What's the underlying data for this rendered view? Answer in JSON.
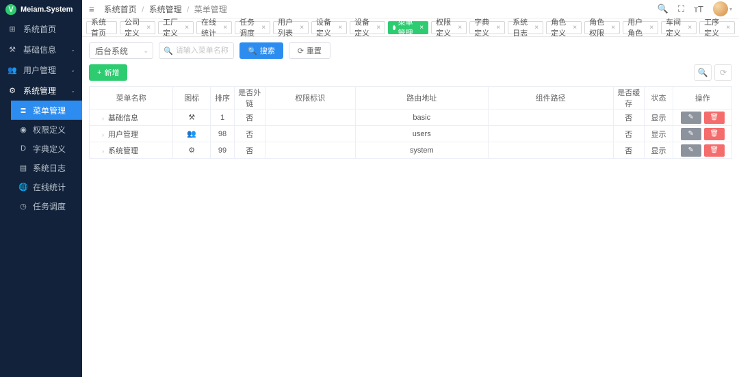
{
  "brand": {
    "initial": "V",
    "name": "Meiam.System"
  },
  "sidebar": {
    "items": [
      {
        "icon": "⊞",
        "label": "系统首页",
        "expandable": false
      },
      {
        "icon": "⚒",
        "label": "基础信息",
        "expandable": true
      },
      {
        "icon": "👥",
        "label": "用户管理",
        "expandable": true
      },
      {
        "icon": "⚙",
        "label": "系统管理",
        "expandable": true,
        "expanded": true
      }
    ],
    "subitems": [
      {
        "icon": "≣",
        "label": "菜单管理",
        "active": true
      },
      {
        "icon": "◉",
        "label": "权限定义"
      },
      {
        "icon": "D",
        "label": "字典定义"
      },
      {
        "icon": "▤",
        "label": "系统日志"
      },
      {
        "icon": "🌐",
        "label": "在线统计"
      },
      {
        "icon": "◷",
        "label": "任务调度"
      }
    ]
  },
  "breadcrumb": {
    "a": "系统首页",
    "b": "系统管理",
    "c": "菜单管理",
    "sep": "/"
  },
  "tabs": [
    {
      "label": "系统首页",
      "closable": false
    },
    {
      "label": "公司定义",
      "closable": true
    },
    {
      "label": "工厂定义",
      "closable": true
    },
    {
      "label": "在线统计",
      "closable": true
    },
    {
      "label": "任务调度",
      "closable": true
    },
    {
      "label": "用户列表",
      "closable": true
    },
    {
      "label": "设备定义",
      "closable": true
    },
    {
      "label": "设备定义",
      "closable": true
    },
    {
      "label": "菜单管理",
      "closable": true,
      "active": true
    },
    {
      "label": "权限定义",
      "closable": true
    },
    {
      "label": "字典定义",
      "closable": true
    },
    {
      "label": "系统日志",
      "closable": true
    },
    {
      "label": "角色定义",
      "closable": true
    },
    {
      "label": "角色权限",
      "closable": true
    },
    {
      "label": "用户角色",
      "closable": true
    },
    {
      "label": "车间定义",
      "closable": true
    },
    {
      "label": "工序定义",
      "closable": true
    }
  ],
  "toolbar": {
    "select_value": "后台系统",
    "search_placeholder": "请输入菜单名称",
    "search_btn": "搜索",
    "reset_btn": "重置",
    "add_btn": "新增"
  },
  "table": {
    "headers": {
      "name": "菜单名称",
      "icon": "图标",
      "sort": "排序",
      "external": "是否外链",
      "auth": "权限标识",
      "route": "路由地址",
      "comp": "组件路径",
      "cache": "是否缓存",
      "status": "状态",
      "op": "操作"
    },
    "rows": [
      {
        "name": "基础信息",
        "icon": "⚒",
        "sort": "1",
        "external": "否",
        "auth": "",
        "route": "basic",
        "comp": "",
        "cache": "否",
        "status": "显示"
      },
      {
        "name": "用户管理",
        "icon": "👥",
        "sort": "98",
        "external": "否",
        "auth": "",
        "route": "users",
        "comp": "",
        "cache": "否",
        "status": "显示"
      },
      {
        "name": "系统管理",
        "icon": "⚙",
        "sort": "99",
        "external": "否",
        "auth": "",
        "route": "system",
        "comp": "",
        "cache": "否",
        "status": "显示"
      }
    ]
  },
  "glyphs": {
    "hamburger": "≡",
    "search": "🔍",
    "fullscreen": "⛶",
    "font": "тT",
    "refresh": "⟳",
    "cog": "⚙",
    "close": "×",
    "chev_down": "⌄",
    "chev_right": "›",
    "plus": "+",
    "edit": "✎",
    "trash": "🗑",
    "dot_caret": "▾"
  }
}
